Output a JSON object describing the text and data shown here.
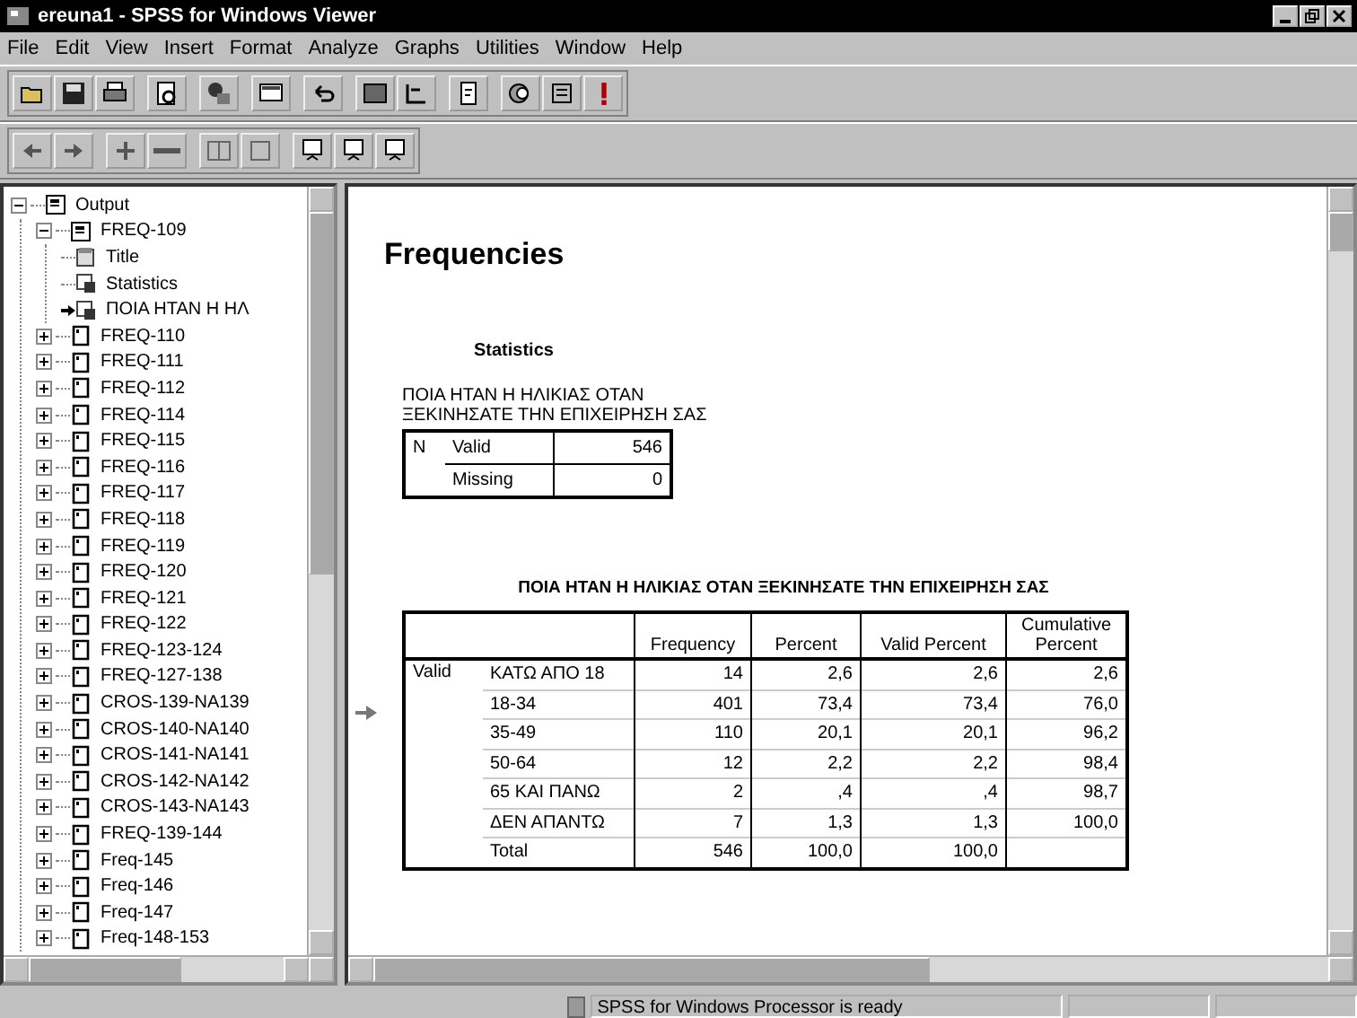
{
  "window": {
    "title": "ereuna1 - SPSS for Windows Viewer"
  },
  "menu": [
    "File",
    "Edit",
    "View",
    "Insert",
    "Format",
    "Analyze",
    "Graphs",
    "Utilities",
    "Window",
    "Help"
  ],
  "outline": [
    {
      "label": "Output",
      "kind": "book",
      "expanded": true,
      "selected": false,
      "children": [
        {
          "label": "FREQ-109",
          "kind": "book",
          "expanded": true,
          "selected": false,
          "children": [
            {
              "label": "Title",
              "kind": "title",
              "selected": false
            },
            {
              "label": "Statistics",
              "kind": "table",
              "selected": false
            },
            {
              "label": "ΠΟΙΑ ΗΤΑΝ Η ΗΛ",
              "kind": "table",
              "selected": true
            }
          ]
        },
        {
          "label": "FREQ-110",
          "kind": "page",
          "expanded": false,
          "selected": false
        },
        {
          "label": "FREQ-111",
          "kind": "page",
          "expanded": false,
          "selected": false
        },
        {
          "label": "FREQ-112",
          "kind": "page",
          "expanded": false,
          "selected": false
        },
        {
          "label": "FREQ-114",
          "kind": "page",
          "expanded": false,
          "selected": false
        },
        {
          "label": "FREQ-115",
          "kind": "page",
          "expanded": false,
          "selected": false
        },
        {
          "label": "FREQ-116",
          "kind": "page",
          "expanded": false,
          "selected": false
        },
        {
          "label": "FREQ-117",
          "kind": "page",
          "expanded": false,
          "selected": false
        },
        {
          "label": "FREQ-118",
          "kind": "page",
          "expanded": false,
          "selected": false
        },
        {
          "label": "FREQ-119",
          "kind": "page",
          "expanded": false,
          "selected": false
        },
        {
          "label": "FREQ-120",
          "kind": "page",
          "expanded": false,
          "selected": false
        },
        {
          "label": "FREQ-121",
          "kind": "page",
          "expanded": false,
          "selected": false
        },
        {
          "label": "FREQ-122",
          "kind": "page",
          "expanded": false,
          "selected": false
        },
        {
          "label": "FREQ-123-124",
          "kind": "page",
          "expanded": false,
          "selected": false
        },
        {
          "label": "FREQ-127-138",
          "kind": "page",
          "expanded": false,
          "selected": false
        },
        {
          "label": "CROS-139-NA139",
          "kind": "page",
          "expanded": false,
          "selected": false
        },
        {
          "label": "CROS-140-NA140",
          "kind": "page",
          "expanded": false,
          "selected": false
        },
        {
          "label": "CROS-141-NA141",
          "kind": "page",
          "expanded": false,
          "selected": false
        },
        {
          "label": "CROS-142-NA142",
          "kind": "page",
          "expanded": false,
          "selected": false
        },
        {
          "label": "CROS-143-NA143",
          "kind": "page",
          "expanded": false,
          "selected": false
        },
        {
          "label": "FREQ-139-144",
          "kind": "page",
          "expanded": false,
          "selected": false
        },
        {
          "label": "Freq-145",
          "kind": "page",
          "expanded": false,
          "selected": false
        },
        {
          "label": "Freq-146",
          "kind": "page",
          "expanded": false,
          "selected": false
        },
        {
          "label": "Freq-147",
          "kind": "page",
          "expanded": false,
          "selected": false
        },
        {
          "label": "Freq-148-153",
          "kind": "page",
          "expanded": false,
          "selected": false
        }
      ]
    }
  ],
  "content": {
    "heading": "Frequencies",
    "statistics": {
      "title": "Statistics",
      "caption_lines": [
        "ΠΟΙΑ ΗΤΑΝ Η ΗΛΙΚΙΑΣ ΟΤΑΝ",
        "ΞΕΚΙΝΗΣΑΤΕ ΤΗΝ ΕΠΙΧΕΙΡΗΣΗ ΣΑΣ"
      ],
      "group": "N",
      "rows": [
        {
          "label": "Valid",
          "value": "546"
        },
        {
          "label": "Missing",
          "value": "0"
        }
      ]
    },
    "frequency_table": {
      "title": "ΠΟΙΑ ΗΤΑΝ Η ΗΛΙΚΙΑΣ ΟΤΑΝ ΞΕΚΙΝΗΣΑΤΕ ΤΗΝ ΕΠΙΧΕΙΡΗΣΗ ΣΑΣ",
      "columns": [
        "Frequency",
        "Percent",
        "Valid Percent",
        "Cumulative Percent"
      ],
      "group": "Valid",
      "rows": [
        {
          "label": "ΚΑΤΩ ΑΠΟ 18",
          "values": [
            "14",
            "2,6",
            "2,6",
            "2,6"
          ]
        },
        {
          "label": "18-34",
          "values": [
            "401",
            "73,4",
            "73,4",
            "76,0"
          ]
        },
        {
          "label": "35-49",
          "values": [
            "110",
            "20,1",
            "20,1",
            "96,2"
          ]
        },
        {
          "label": "50-64",
          "values": [
            "12",
            "2,2",
            "2,2",
            "98,4"
          ]
        },
        {
          "label": "65 ΚΑΙ ΠΑΝΩ",
          "values": [
            "2",
            ",4",
            ",4",
            "98,7"
          ]
        },
        {
          "label": "ΔΕΝ ΑΠΑΝΤΩ",
          "values": [
            "7",
            "1,3",
            "1,3",
            "100,0"
          ]
        },
        {
          "label": "Total",
          "values": [
            "546",
            "100,0",
            "100,0"
          ]
        }
      ]
    }
  },
  "status_bar": {
    "text": "SPSS for Windows Processor is ready"
  }
}
